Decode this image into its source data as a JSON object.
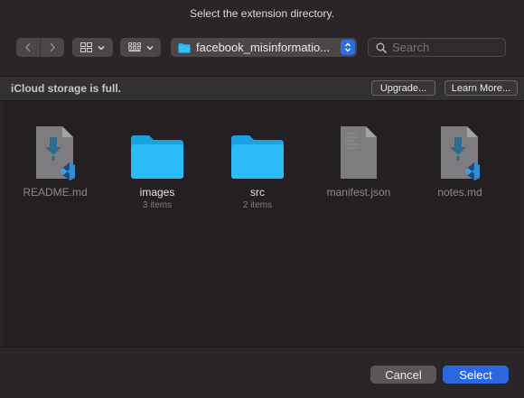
{
  "dialog": {
    "title": "Select the extension directory."
  },
  "toolbar": {
    "back_icon": "chevron-left-icon",
    "forward_icon": "chevron-right-icon",
    "path_label": "facebook_misinformatio...",
    "search_placeholder": "Search"
  },
  "banner": {
    "message": "iCloud storage is full.",
    "upgrade_label": "Upgrade...",
    "learn_more_label": "Learn More..."
  },
  "files": [
    {
      "name": "README.md",
      "type": "vscode-doc",
      "count": ""
    },
    {
      "name": "images",
      "type": "folder",
      "count": "3 items"
    },
    {
      "name": "src",
      "type": "folder",
      "count": "2 items"
    },
    {
      "name": "manifest.json",
      "type": "doc",
      "count": ""
    },
    {
      "name": "notes.md",
      "type": "vscode-doc",
      "count": ""
    }
  ],
  "footer": {
    "cancel_label": "Cancel",
    "select_label": "Select"
  },
  "colors": {
    "accent": "#2b68dd",
    "folder": "#1fb6f5",
    "background": "#2a2528"
  }
}
